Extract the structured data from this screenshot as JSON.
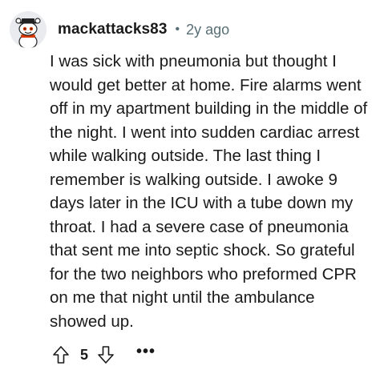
{
  "comment": {
    "username": "mackattacks83",
    "separator": "•",
    "age": "2y ago",
    "body": "I was sick with pneumonia but thought I would get better at home. Fire alarms went off in my apartment building in the middle of the night. I went into sudden cardiac arrest while walking outside. The last thing I remember is walking outside. I awoke 9 days later in the ICU with a tube down my throat. I had a severe case of pneumonia that sent me into septic shock. So grateful for the two neighbors who preformed CPR on me that night until the ambulance showed up.",
    "votes": "5",
    "more_label": "•••"
  },
  "icons": {
    "avatar": "snoo-avatar-icon",
    "upvote": "upvote-arrow-icon",
    "downvote": "downvote-arrow-icon"
  },
  "colors": {
    "text": "#1a1a1b",
    "meta": "#576f76",
    "avatar_bg": "#e9ebee"
  }
}
